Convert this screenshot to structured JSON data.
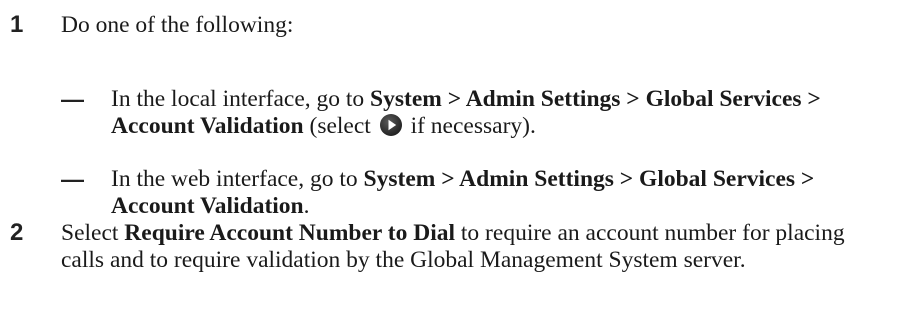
{
  "steps": [
    {
      "number": "1",
      "text": "Do one of the following:",
      "bullets": [
        {
          "marker": "—",
          "before": "In the local interface, go to ",
          "bold": "System > Admin Settings > Global Services > Account Validation",
          "after_pre_icon": " (select ",
          "icon": "play-icon",
          "after_icon": " if necessary)."
        },
        {
          "marker": "—",
          "before": "In the web interface, go to ",
          "bold": "System > Admin Settings > Global Services > Account Validation",
          "after": "."
        }
      ]
    },
    {
      "number": "2",
      "before": "Select ",
      "bold": "Require Account Number to Dial",
      "after": " to require an account number for placing calls and to require validation by the Global Management System server."
    }
  ],
  "colors": {
    "text": "#1a1a1a",
    "icon": "#333333"
  }
}
